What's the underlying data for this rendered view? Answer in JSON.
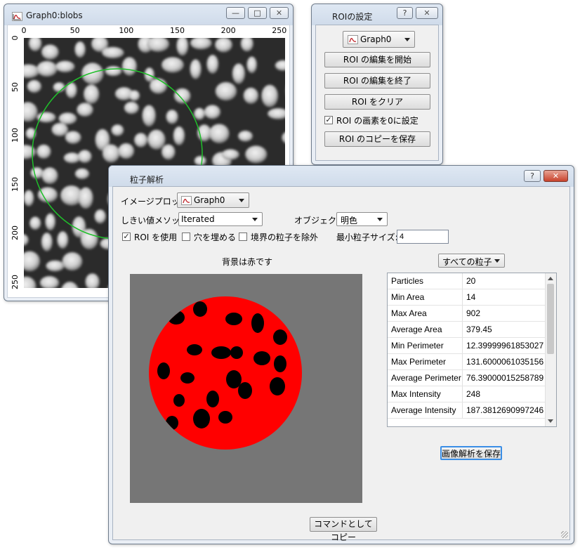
{
  "graph_window": {
    "title": "Graph0:blobs",
    "x_ticks": [
      "0",
      "50",
      "100",
      "150",
      "200",
      "250"
    ],
    "y_ticks": [
      "0",
      "50",
      "100",
      "150",
      "200",
      "250"
    ]
  },
  "roi_window": {
    "title": "ROIの設定",
    "graph_select": "Graph0",
    "start_edit": "ROI の編集を開始",
    "end_edit": "ROI の編集を終了",
    "clear": "ROI をクリア",
    "set_pixels_zero": "ROI の画素を0に設定",
    "set_pixels_zero_checked": true,
    "save_copy": "ROI のコピーを保存"
  },
  "particle_window": {
    "title": "粒子解析",
    "image_plot_label": "イメージプロット:",
    "image_plot_value": "Graph0",
    "threshold_label": "しきい値メソッド:",
    "threshold_value": "Iterated",
    "object_label": "オブジェクト:",
    "object_value": "明色",
    "use_roi_label": "ROI を使用",
    "use_roi_checked": true,
    "fill_holes_label": "穴を埋める",
    "fill_holes_checked": false,
    "exclude_edge_label": "境界の粒子を除外",
    "exclude_edge_checked": false,
    "min_size_label": "最小粒子サイズ:",
    "min_size_value": "4",
    "preview_caption": "背景は赤です",
    "particle_filter": "すべての粒子",
    "save_button": "画像解析を保存",
    "copy_button": "コマンドとしてコピー",
    "stats": [
      {
        "key": "Particles",
        "value": "20"
      },
      {
        "key": "Min Area",
        "value": "14"
      },
      {
        "key": "Max Area",
        "value": "902"
      },
      {
        "key": "Average Area",
        "value": "379.45"
      },
      {
        "key": "Min Perimeter",
        "value": "12.39999961853027"
      },
      {
        "key": "Max Perimeter",
        "value": "131.6000061035156"
      },
      {
        "key": "Average Perimeter",
        "value": "76.39000015258789"
      },
      {
        "key": "Max Intensity",
        "value": "248"
      },
      {
        "key": "Average Intensity",
        "value": "187.3812690997246"
      }
    ]
  },
  "colors": {
    "roi_circle": "#1fbf2a",
    "particle_background": "#ff0000",
    "particle": "#000000",
    "preview_gray": "#767676",
    "default_button_border": "#3a8ee6"
  }
}
